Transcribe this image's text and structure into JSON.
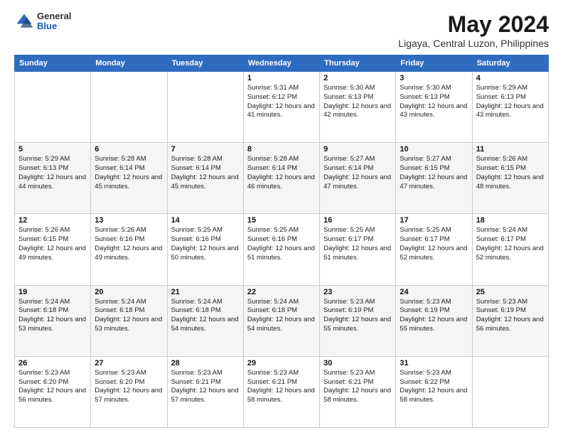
{
  "logo": {
    "general": "General",
    "blue": "Blue"
  },
  "title": "May 2024",
  "subtitle": "Ligaya, Central Luzon, Philippines",
  "weekdays": [
    "Sunday",
    "Monday",
    "Tuesday",
    "Wednesday",
    "Thursday",
    "Friday",
    "Saturday"
  ],
  "weeks": [
    [
      {
        "day": "",
        "sunrise": "",
        "sunset": "",
        "daylight": ""
      },
      {
        "day": "",
        "sunrise": "",
        "sunset": "",
        "daylight": ""
      },
      {
        "day": "",
        "sunrise": "",
        "sunset": "",
        "daylight": ""
      },
      {
        "day": "1",
        "sunrise": "Sunrise: 5:31 AM",
        "sunset": "Sunset: 6:12 PM",
        "daylight": "Daylight: 12 hours and 41 minutes."
      },
      {
        "day": "2",
        "sunrise": "Sunrise: 5:30 AM",
        "sunset": "Sunset: 6:13 PM",
        "daylight": "Daylight: 12 hours and 42 minutes."
      },
      {
        "day": "3",
        "sunrise": "Sunrise: 5:30 AM",
        "sunset": "Sunset: 6:13 PM",
        "daylight": "Daylight: 12 hours and 43 minutes."
      },
      {
        "day": "4",
        "sunrise": "Sunrise: 5:29 AM",
        "sunset": "Sunset: 6:13 PM",
        "daylight": "Daylight: 12 hours and 43 minutes."
      }
    ],
    [
      {
        "day": "5",
        "sunrise": "Sunrise: 5:29 AM",
        "sunset": "Sunset: 6:13 PM",
        "daylight": "Daylight: 12 hours and 44 minutes."
      },
      {
        "day": "6",
        "sunrise": "Sunrise: 5:28 AM",
        "sunset": "Sunset: 6:14 PM",
        "daylight": "Daylight: 12 hours and 45 minutes."
      },
      {
        "day": "7",
        "sunrise": "Sunrise: 5:28 AM",
        "sunset": "Sunset: 6:14 PM",
        "daylight": "Daylight: 12 hours and 45 minutes."
      },
      {
        "day": "8",
        "sunrise": "Sunrise: 5:28 AM",
        "sunset": "Sunset: 6:14 PM",
        "daylight": "Daylight: 12 hours and 46 minutes."
      },
      {
        "day": "9",
        "sunrise": "Sunrise: 5:27 AM",
        "sunset": "Sunset: 6:14 PM",
        "daylight": "Daylight: 12 hours and 47 minutes."
      },
      {
        "day": "10",
        "sunrise": "Sunrise: 5:27 AM",
        "sunset": "Sunset: 6:15 PM",
        "daylight": "Daylight: 12 hours and 47 minutes."
      },
      {
        "day": "11",
        "sunrise": "Sunrise: 5:26 AM",
        "sunset": "Sunset: 6:15 PM",
        "daylight": "Daylight: 12 hours and 48 minutes."
      }
    ],
    [
      {
        "day": "12",
        "sunrise": "Sunrise: 5:26 AM",
        "sunset": "Sunset: 6:15 PM",
        "daylight": "Daylight: 12 hours and 49 minutes."
      },
      {
        "day": "13",
        "sunrise": "Sunrise: 5:26 AM",
        "sunset": "Sunset: 6:16 PM",
        "daylight": "Daylight: 12 hours and 49 minutes."
      },
      {
        "day": "14",
        "sunrise": "Sunrise: 5:25 AM",
        "sunset": "Sunset: 6:16 PM",
        "daylight": "Daylight: 12 hours and 50 minutes."
      },
      {
        "day": "15",
        "sunrise": "Sunrise: 5:25 AM",
        "sunset": "Sunset: 6:16 PM",
        "daylight": "Daylight: 12 hours and 51 minutes."
      },
      {
        "day": "16",
        "sunrise": "Sunrise: 5:25 AM",
        "sunset": "Sunset: 6:17 PM",
        "daylight": "Daylight: 12 hours and 51 minutes."
      },
      {
        "day": "17",
        "sunrise": "Sunrise: 5:25 AM",
        "sunset": "Sunset: 6:17 PM",
        "daylight": "Daylight: 12 hours and 52 minutes."
      },
      {
        "day": "18",
        "sunrise": "Sunrise: 5:24 AM",
        "sunset": "Sunset: 6:17 PM",
        "daylight": "Daylight: 12 hours and 52 minutes."
      }
    ],
    [
      {
        "day": "19",
        "sunrise": "Sunrise: 5:24 AM",
        "sunset": "Sunset: 6:18 PM",
        "daylight": "Daylight: 12 hours and 53 minutes."
      },
      {
        "day": "20",
        "sunrise": "Sunrise: 5:24 AM",
        "sunset": "Sunset: 6:18 PM",
        "daylight": "Daylight: 12 hours and 53 minutes."
      },
      {
        "day": "21",
        "sunrise": "Sunrise: 5:24 AM",
        "sunset": "Sunset: 6:18 PM",
        "daylight": "Daylight: 12 hours and 54 minutes."
      },
      {
        "day": "22",
        "sunrise": "Sunrise: 5:24 AM",
        "sunset": "Sunset: 6:18 PM",
        "daylight": "Daylight: 12 hours and 54 minutes."
      },
      {
        "day": "23",
        "sunrise": "Sunrise: 5:23 AM",
        "sunset": "Sunset: 6:19 PM",
        "daylight": "Daylight: 12 hours and 55 minutes."
      },
      {
        "day": "24",
        "sunrise": "Sunrise: 5:23 AM",
        "sunset": "Sunset: 6:19 PM",
        "daylight": "Daylight: 12 hours and 55 minutes."
      },
      {
        "day": "25",
        "sunrise": "Sunrise: 5:23 AM",
        "sunset": "Sunset: 6:19 PM",
        "daylight": "Daylight: 12 hours and 56 minutes."
      }
    ],
    [
      {
        "day": "26",
        "sunrise": "Sunrise: 5:23 AM",
        "sunset": "Sunset: 6:20 PM",
        "daylight": "Daylight: 12 hours and 56 minutes."
      },
      {
        "day": "27",
        "sunrise": "Sunrise: 5:23 AM",
        "sunset": "Sunset: 6:20 PM",
        "daylight": "Daylight: 12 hours and 57 minutes."
      },
      {
        "day": "28",
        "sunrise": "Sunrise: 5:23 AM",
        "sunset": "Sunset: 6:21 PM",
        "daylight": "Daylight: 12 hours and 57 minutes."
      },
      {
        "day": "29",
        "sunrise": "Sunrise: 5:23 AM",
        "sunset": "Sunset: 6:21 PM",
        "daylight": "Daylight: 12 hours and 58 minutes."
      },
      {
        "day": "30",
        "sunrise": "Sunrise: 5:23 AM",
        "sunset": "Sunset: 6:21 PM",
        "daylight": "Daylight: 12 hours and 58 minutes."
      },
      {
        "day": "31",
        "sunrise": "Sunrise: 5:23 AM",
        "sunset": "Sunset: 6:22 PM",
        "daylight": "Daylight: 12 hours and 58 minutes."
      },
      {
        "day": "",
        "sunrise": "",
        "sunset": "",
        "daylight": ""
      }
    ]
  ]
}
